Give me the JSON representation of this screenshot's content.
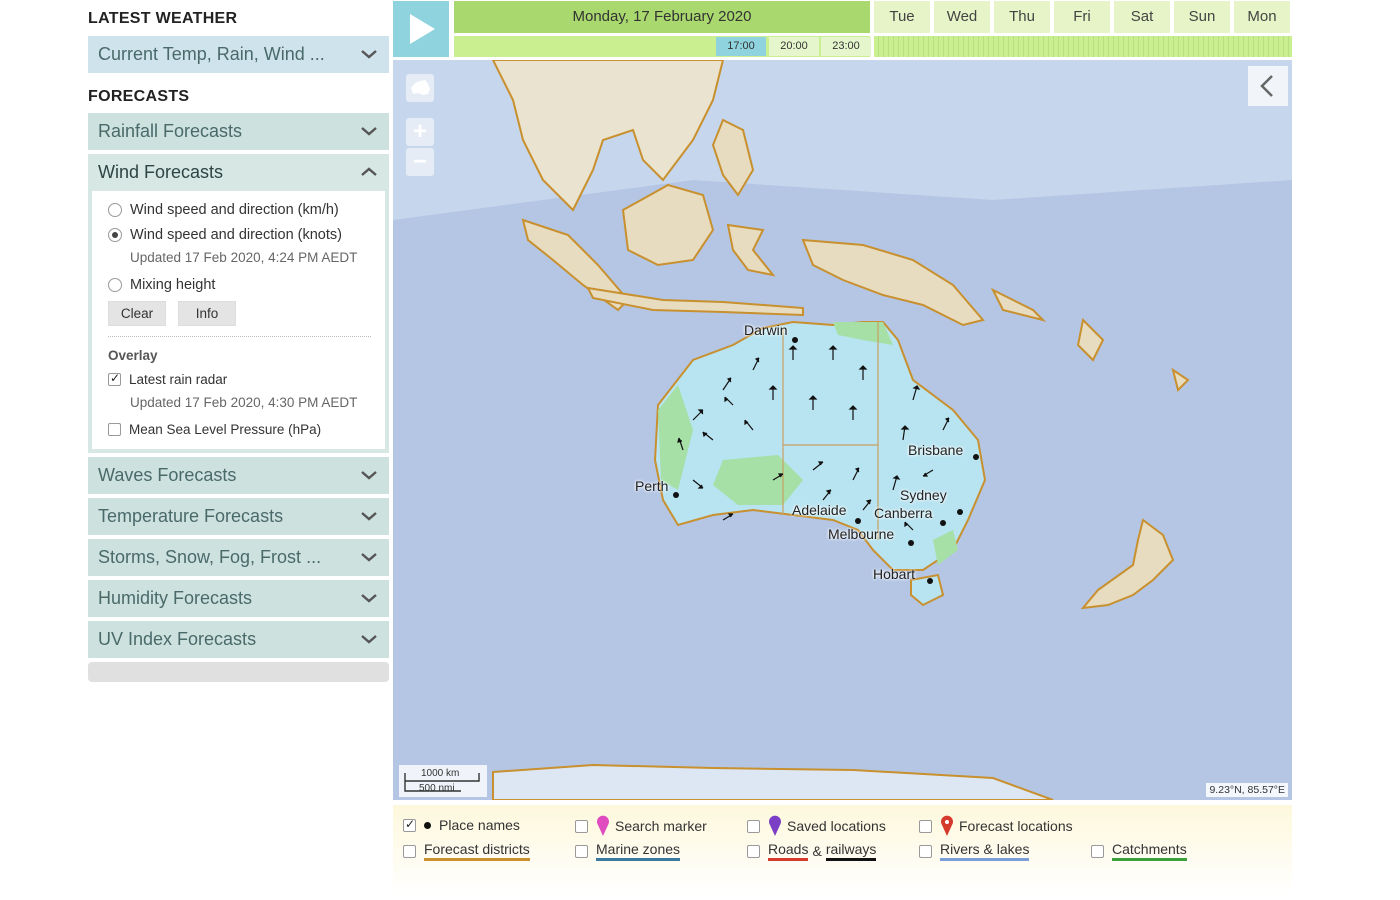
{
  "sidebar": {
    "latest_heading": "LATEST WEATHER",
    "latest_item": "Current Temp, Rain, Wind ...",
    "forecasts_heading": "FORECASTS",
    "rainfall": "Rainfall Forecasts",
    "wind": "Wind Forecasts",
    "wind_options": {
      "kmh": "Wind speed and direction (km/h)",
      "knots": "Wind speed and direction (knots)",
      "knots_updated": "Updated 17 Feb 2020, 4:24 PM AEDT",
      "mixing": "Mixing height",
      "selected": "Wind speed and direction (knots)"
    },
    "clear_label": "Clear",
    "info_label": "Info",
    "overlay_heading": "Overlay",
    "radar_label": "Latest rain radar",
    "radar_updated": "Updated 17 Feb 2020, 4:30 PM AEDT",
    "radar_checked": true,
    "mslp_label": "Mean Sea Level Pressure (hPa)",
    "mslp_checked": false,
    "waves": "Waves Forecasts",
    "temperature": "Temperature Forecasts",
    "storms": "Storms, Snow, Fog, Frost ...",
    "humidity": "Humidity Forecasts",
    "uv": "UV Index Forecasts"
  },
  "timeline": {
    "current_day": "Monday, 17 February 2020",
    "days": [
      "Tue",
      "Wed",
      "Thu",
      "Fri",
      "Sat",
      "Sun",
      "Mon"
    ],
    "hours": [
      "17:00",
      "20:00",
      "23:00"
    ],
    "selected_hour": "17:00"
  },
  "map": {
    "places": [
      "Darwin",
      "Brisbane",
      "Perth",
      "Sydney",
      "Adelaide",
      "Canberra",
      "Melbourne",
      "Hobart"
    ],
    "scale_km": "1000 km",
    "scale_nmi": "500 nmi",
    "coords": "9.23°N, 85.57°E",
    "colors": {
      "ocean": "#b9cae6",
      "land": "#eae3cf",
      "coast": "#c8902e",
      "wind_strong": "#b8e3f0",
      "wind_light": "#9fe3a0"
    }
  },
  "legend": {
    "place_names": "Place names",
    "place_names_checked": true,
    "search_marker": "Search marker",
    "saved_locations": "Saved locations",
    "forecast_locations": "Forecast locations",
    "forecast_districts": "Forecast districts",
    "marine_zones": "Marine zones",
    "roads": "Roads",
    "amp": "&",
    "railways": "railways",
    "rivers": "Rivers & lakes",
    "catchments": "Catchments"
  }
}
